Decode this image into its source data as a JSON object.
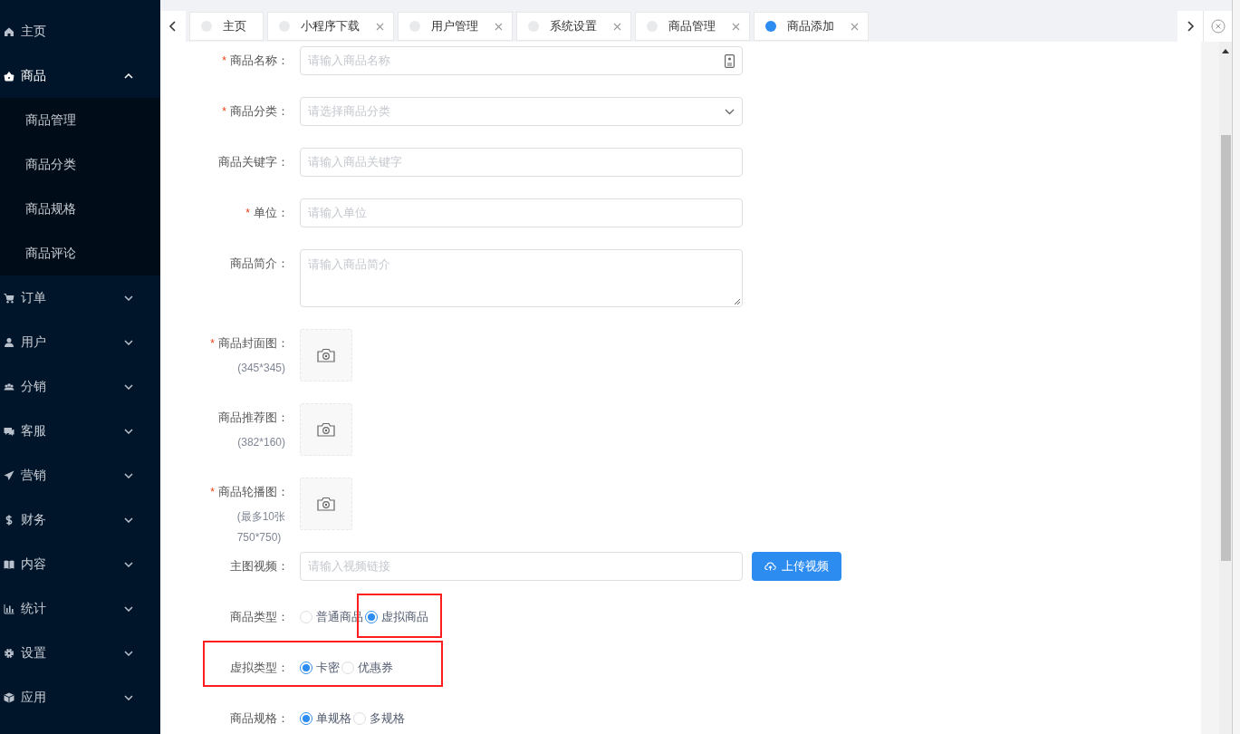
{
  "sidebar": {
    "items": [
      {
        "kind": "link",
        "label": "主页"
      },
      {
        "kind": "menu",
        "label": "商品",
        "expanded": true,
        "children": [
          {
            "label": "商品管理"
          },
          {
            "label": "商品分类"
          },
          {
            "label": "商品规格"
          },
          {
            "label": "商品评论"
          }
        ]
      },
      {
        "kind": "menu",
        "label": "订单",
        "expanded": false
      },
      {
        "kind": "menu",
        "label": "用户",
        "expanded": false
      },
      {
        "kind": "menu",
        "label": "分销",
        "expanded": false
      },
      {
        "kind": "menu",
        "label": "客服",
        "expanded": false
      },
      {
        "kind": "menu",
        "label": "营销",
        "expanded": false
      },
      {
        "kind": "menu",
        "label": "财务",
        "expanded": false
      },
      {
        "kind": "menu",
        "label": "内容",
        "expanded": false
      },
      {
        "kind": "menu",
        "label": "统计",
        "expanded": false
      },
      {
        "kind": "menu",
        "label": "设置",
        "expanded": false
      },
      {
        "kind": "menu",
        "label": "应用",
        "expanded": false
      }
    ]
  },
  "tabs": [
    {
      "label": "主页",
      "selected": false,
      "closable": false
    },
    {
      "label": "小程序下载",
      "selected": false,
      "closable": true
    },
    {
      "label": "用户管理",
      "selected": false,
      "closable": true
    },
    {
      "label": "系统设置",
      "selected": false,
      "closable": true
    },
    {
      "label": "商品管理",
      "selected": false,
      "closable": true
    },
    {
      "label": "商品添加",
      "selected": true,
      "closable": true
    }
  ],
  "form": {
    "rows": [
      {
        "kind": "card_input",
        "label": "商品名称：",
        "required_mark": "*",
        "placeholder": "请输入商品名称"
      },
      {
        "kind": "select",
        "label": "商品分类：",
        "required_mark": "*",
        "placeholder": "请选择商品分类"
      },
      {
        "kind": "input",
        "label": "商品关键字：",
        "placeholder": "请输入商品关键字"
      },
      {
        "kind": "input",
        "label": "单位：",
        "required_mark": "*",
        "placeholder": "请输入单位"
      },
      {
        "kind": "textarea",
        "label": "商品简介：",
        "placeholder": "请输入商品简介"
      },
      {
        "kind": "upload",
        "label": "商品封面图：",
        "required_mark": "*",
        "hint": [
          "(345*345)"
        ]
      },
      {
        "kind": "upload",
        "label": "商品推荐图：",
        "hint": [
          "(382*160)"
        ]
      },
      {
        "kind": "upload",
        "label": "商品轮播图：",
        "required_mark": "*",
        "hint": [
          "(最多10张",
          "750*750)"
        ]
      },
      {
        "kind": "video",
        "label": "主图视频：",
        "placeholder": "请输入视频链接",
        "button": "上传视频"
      },
      {
        "kind": "radio",
        "label": "商品类型：",
        "options": [
          {
            "label": "普通商品",
            "selected": false
          },
          {
            "label": "虚拟商品",
            "selected": true,
            "highlighted": true
          }
        ]
      },
      {
        "kind": "radio",
        "label": "虚拟类型：",
        "highlighted": true,
        "options": [
          {
            "label": "卡密",
            "selected": true
          },
          {
            "label": "优惠券",
            "selected": false
          }
        ]
      },
      {
        "kind": "radio",
        "label": "商品规格：",
        "options": [
          {
            "label": "单规格",
            "selected": true
          },
          {
            "label": "多规格",
            "selected": false
          }
        ]
      }
    ]
  }
}
